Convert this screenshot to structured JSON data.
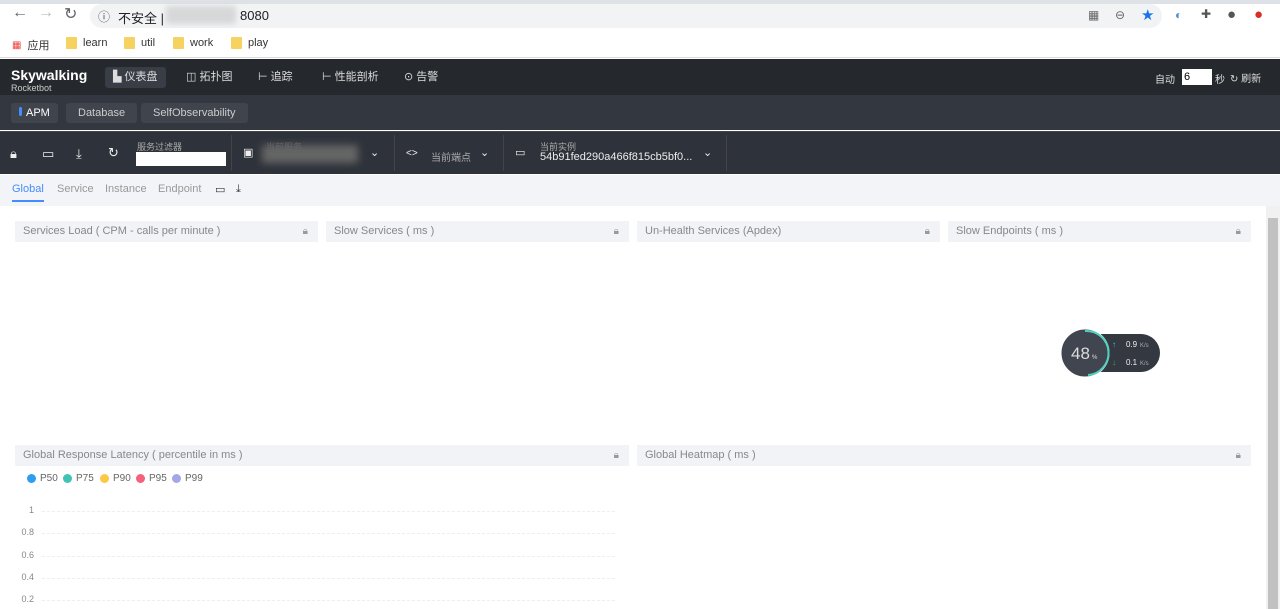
{
  "browser": {
    "url_prefix": "不安全 |",
    "url_suffix": "8080",
    "bookmarks": [
      "应用",
      "learn",
      "util",
      "work",
      "play"
    ]
  },
  "nav": {
    "logo": "Skywalking",
    "logo_sub": "Rocketbot",
    "items": [
      "仪表盘",
      "拓扑图",
      "追踪",
      "性能剖析",
      "告警"
    ],
    "auto_label": "自动",
    "auto_value": "6",
    "seconds": "秒",
    "refresh": "刷新"
  },
  "subnav": [
    "APM",
    "Database",
    "SelfObservability"
  ],
  "toolbar": {
    "filter_label": "服务过滤器",
    "filter_value": "",
    "service_label": "当前服务",
    "endpoint_label": "当前端点",
    "instance_label": "当前实例",
    "instance_value": "54b91fed290a466f815cb5bf0..."
  },
  "tabs": [
    "Global",
    "Service",
    "Instance",
    "Endpoint"
  ],
  "panels": {
    "p1": "Services Load ( CPM - calls per minute )",
    "p2": "Slow Services ( ms )",
    "p3": "Un-Health Services (Apdex)",
    "p4": "Slow Endpoints ( ms )",
    "p5": "Global Response Latency ( percentile in ms )",
    "p6": "Global Heatmap ( ms )"
  },
  "legend": [
    {
      "name": "P50",
      "color": "#2d9df0"
    },
    {
      "name": "P75",
      "color": "#3ec3b6"
    },
    {
      "name": "P90",
      "color": "#fec745"
    },
    {
      "name": "P95",
      "color": "#f5617b"
    },
    {
      "name": "P99",
      "color": "#a5a7e5"
    }
  ],
  "chart_data": {
    "type": "line",
    "title": "Global Response Latency ( percentile in ms )",
    "yticks": [
      "1",
      "0.8",
      "0.6",
      "0.4",
      "0.2"
    ],
    "series": [
      {
        "name": "P50",
        "values": []
      },
      {
        "name": "P75",
        "values": []
      },
      {
        "name": "P90",
        "values": []
      },
      {
        "name": "P95",
        "values": []
      },
      {
        "name": "P99",
        "values": []
      }
    ]
  },
  "gauge": {
    "percent": "48",
    "unit": "%",
    "up": "0.9",
    "down": "0.1",
    "rate_unit": "K/s"
  }
}
